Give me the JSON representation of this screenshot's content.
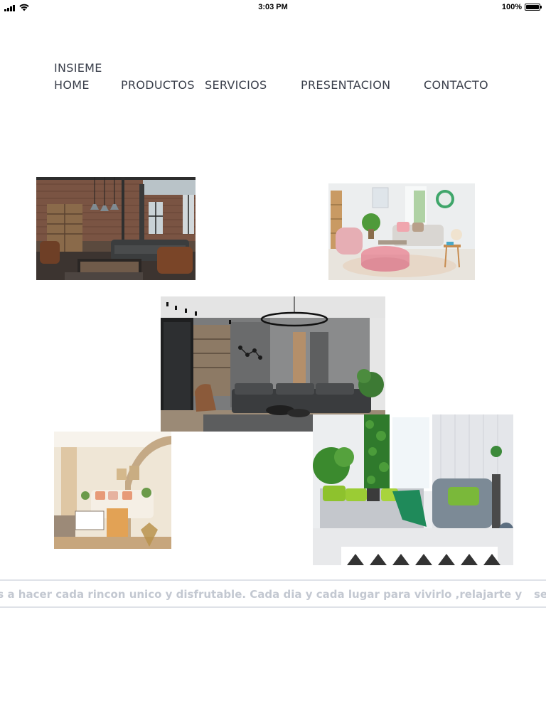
{
  "status_bar": {
    "time": "3:03 PM",
    "battery_text": "100%",
    "battery_level": 1.0,
    "icons": [
      "signal-icon",
      "wifi-icon",
      "battery-icon"
    ]
  },
  "nav": {
    "brand": "INSIEME",
    "items": [
      {
        "label": "HOME"
      },
      {
        "label": "PRODUCTOS"
      },
      {
        "label": "SERVICIOS"
      },
      {
        "label": "PRESENTACION"
      },
      {
        "label": "CONTACTO"
      }
    ]
  },
  "gallery": {
    "images": [
      {
        "subject": "industrial-living-room"
      },
      {
        "subject": "pastel-living-room"
      },
      {
        "subject": "modern-grey-living-room"
      },
      {
        "subject": "warm-classic-living-room"
      },
      {
        "subject": "green-accent-living-room"
      }
    ]
  },
  "ticker": {
    "text": "os a hacer cada rincon unico y disfrutable. Cada dia y cada lugar para vivirlo ,relajarte y",
    "text_continued": "se"
  },
  "colors": {
    "text": "#3a3f4b",
    "ticker_text": "#c3c8d1",
    "ticker_border": "#dfe2e8",
    "background": "#ffffff"
  }
}
